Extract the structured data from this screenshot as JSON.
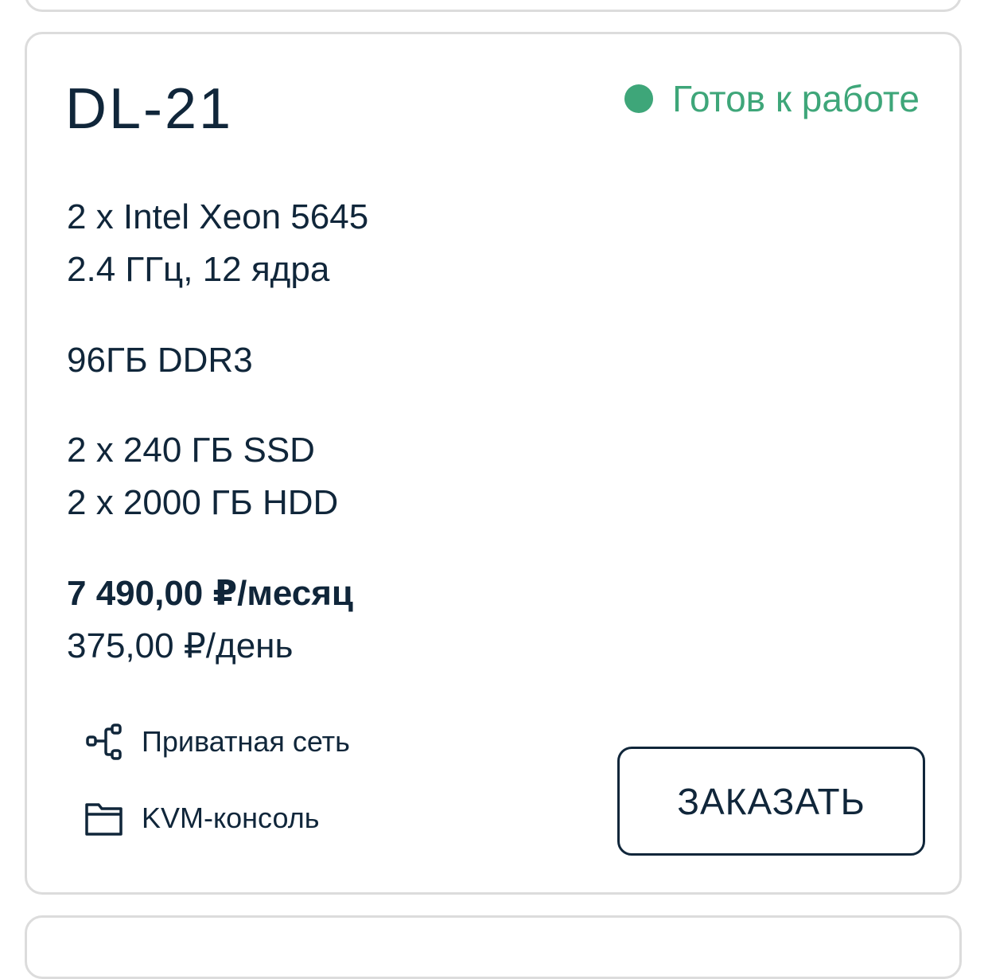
{
  "server": {
    "name": "DL-21",
    "status": {
      "label": "Готов к работе",
      "color": "#3ea679"
    },
    "cpu": {
      "line1": "2 x Intel Xeon 5645",
      "line2": "2.4 ГГц, 12 ядра"
    },
    "ram": "96ГБ DDR3",
    "storage": {
      "line1": "2 x 240 ГБ SSD",
      "line2": "2 x 2000 ГБ HDD"
    },
    "price": {
      "monthly": "7 490,00 ₽/месяц",
      "daily": "375,00 ₽/день"
    },
    "features": [
      {
        "icon": "network-icon",
        "label": "Приватная сеть"
      },
      {
        "icon": "folder-icon",
        "label": "KVM-консоль"
      }
    ],
    "order_label": "ЗАКАЗАТЬ"
  }
}
